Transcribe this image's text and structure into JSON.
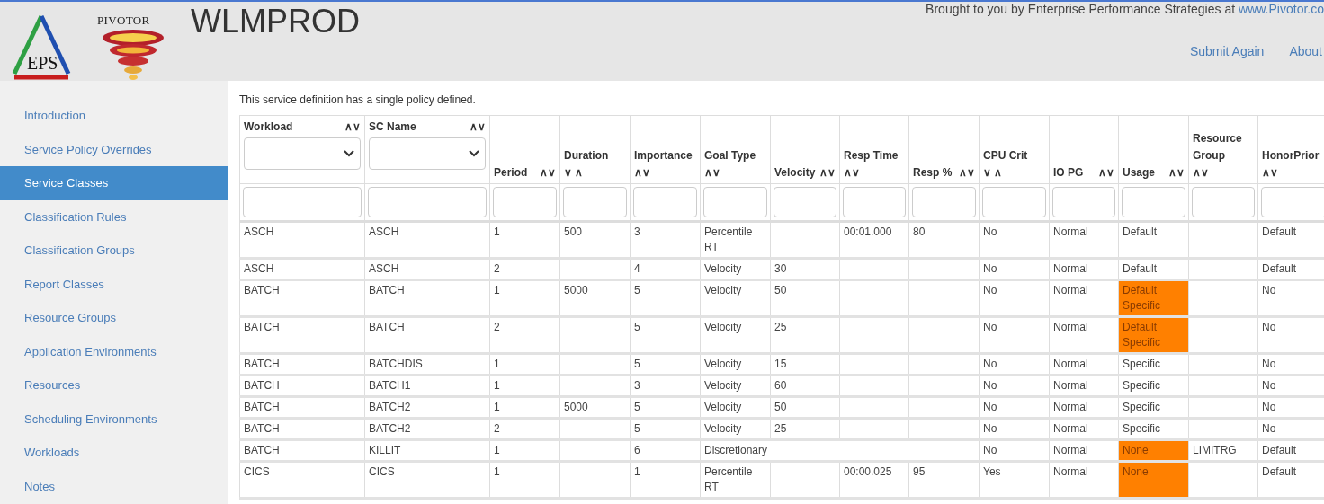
{
  "header": {
    "logo_eps": "EPS",
    "logo_pivotor": "PIVOTOR",
    "title": "WLMPROD",
    "credit": "Brought to you by Enterprise Performance Strategies at",
    "credit_link": "www.Pivotor.co",
    "links": [
      "Submit Again",
      "About"
    ]
  },
  "sidebar": {
    "items": [
      {
        "label": "Introduction",
        "selected": false
      },
      {
        "label": "Service Policy Overrides",
        "selected": false
      },
      {
        "label": "Service Classes",
        "selected": true
      },
      {
        "label": "Classification Rules",
        "selected": false
      },
      {
        "label": "Classification Groups",
        "selected": false
      },
      {
        "label": "Report Classes",
        "selected": false
      },
      {
        "label": "Resource Groups",
        "selected": false
      },
      {
        "label": "Application Environments",
        "selected": false
      },
      {
        "label": "Resources",
        "selected": false
      },
      {
        "label": "Scheduling Environments",
        "selected": false
      },
      {
        "label": "Workloads",
        "selected": false
      },
      {
        "label": "Notes",
        "selected": false
      }
    ]
  },
  "description": "This service definition has a single policy defined.",
  "table": {
    "columns": [
      {
        "label": "Workload",
        "sort": "∧∨",
        "kind": "select"
      },
      {
        "label": "SC Name",
        "sort": "∧∨",
        "kind": "select"
      },
      {
        "label": "Period",
        "sort": "∧∨",
        "kind": "text"
      },
      {
        "label": "Duration",
        "sort": "∨ ∧",
        "kind": "text"
      },
      {
        "label": "Importance",
        "sort": "∧∨",
        "kind": "text"
      },
      {
        "label": "Goal Type",
        "sort": "∧∨",
        "kind": "text"
      },
      {
        "label": "Velocity",
        "sort": "∧∨",
        "kind": "text"
      },
      {
        "label": "Resp Time",
        "sort": "∧∨",
        "kind": "text"
      },
      {
        "label": "Resp %",
        "sort": "∧∨",
        "kind": "text"
      },
      {
        "label": "CPU Crit",
        "sort": "∨ ∧",
        "kind": "text"
      },
      {
        "label": "IO PG",
        "sort": "∧∨",
        "kind": "text"
      },
      {
        "label": "Usage",
        "sort": "∧∨",
        "kind": "text"
      },
      {
        "label": "Resource Group",
        "sort": "∧∨",
        "kind": "text"
      },
      {
        "label": "HonorPrior",
        "sort": "∧∨",
        "kind": "text"
      }
    ],
    "rows": [
      {
        "cells": [
          "ASCH",
          "ASCH",
          "1",
          "500",
          "3",
          "Percentile RT",
          "",
          "00:01.000",
          "80",
          "No",
          "Normal",
          "Default",
          "",
          "Default"
        ],
        "usage_flagged": false
      },
      {
        "cells": [
          "ASCH",
          "ASCH",
          "2",
          "",
          "4",
          "Velocity",
          "30",
          "",
          "",
          "No",
          "Normal",
          "Default",
          "",
          "Default"
        ],
        "usage_flagged": false
      },
      {
        "cells": [
          "BATCH",
          "BATCH",
          "1",
          "5000",
          "5",
          "Velocity",
          "50",
          "",
          "",
          "No",
          "Normal",
          "Default Specific",
          "",
          "No"
        ],
        "usage_flagged": true
      },
      {
        "cells": [
          "BATCH",
          "BATCH",
          "2",
          "",
          "5",
          "Velocity",
          "25",
          "",
          "",
          "No",
          "Normal",
          "Default Specific",
          "",
          "No"
        ],
        "usage_flagged": true
      },
      {
        "cells": [
          "BATCH",
          "BATCHDIS",
          "1",
          "",
          "5",
          "Velocity",
          "15",
          "",
          "",
          "No",
          "Normal",
          "Specific",
          "",
          "No"
        ],
        "usage_flagged": false
      },
      {
        "cells": [
          "BATCH",
          "BATCH1",
          "1",
          "",
          "3",
          "Velocity",
          "60",
          "",
          "",
          "No",
          "Normal",
          "Specific",
          "",
          "No"
        ],
        "usage_flagged": false
      },
      {
        "cells": [
          "BATCH",
          "BATCH2",
          "1",
          "5000",
          "5",
          "Velocity",
          "50",
          "",
          "",
          "No",
          "Normal",
          "Specific",
          "",
          "No"
        ],
        "usage_flagged": false
      },
      {
        "cells": [
          "BATCH",
          "BATCH2",
          "2",
          "",
          "5",
          "Velocity",
          "25",
          "",
          "",
          "No",
          "Normal",
          "Specific",
          "",
          "No"
        ],
        "usage_flagged": false
      },
      {
        "kind": "discretionary",
        "cells": [
          "BATCH",
          "KILLIT",
          "1",
          "",
          "6",
          "Discretionary",
          "",
          "",
          "",
          "No",
          "Normal",
          "None",
          "LIMITRG",
          "Default"
        ],
        "usage_flagged": true
      },
      {
        "cells": [
          "CICS",
          "CICS",
          "1",
          "",
          "1",
          "Percentile RT",
          "",
          "00:00.025",
          "95",
          "Yes",
          "Normal",
          "None",
          "",
          "Default"
        ],
        "usage_flagged": true
      }
    ]
  }
}
